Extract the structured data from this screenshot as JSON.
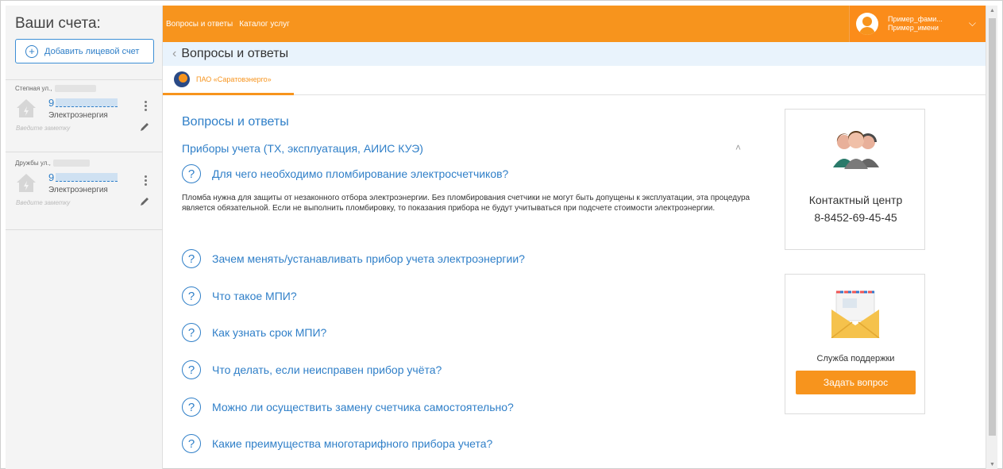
{
  "sidebar": {
    "title": "Ваши счета:",
    "add_account_label": "Добавить лицевой счет",
    "accounts": [
      {
        "address": "Степная ул.,",
        "number_prefix": "9",
        "type": "Электроэнергия",
        "note_placeholder": "Введите заметку"
      },
      {
        "address": "Дружбы ул.,",
        "number_prefix": "9",
        "type": "Электроэнергия",
        "note_placeholder": "Введите заметку"
      }
    ]
  },
  "topbar": {
    "nav": [
      "Вопросы и ответы",
      "Каталог услуг"
    ],
    "user_line1": "Пример_фами...",
    "user_line2": "Пример_имени"
  },
  "breadcrumb": {
    "title": "Вопросы и ответы"
  },
  "company_tab": {
    "name": "ПАО «Саратовэнерго»"
  },
  "faq": {
    "heading": "Вопросы и ответы",
    "section_title": "Приборы учета (ТХ, эксплуатация, АИИС КУЭ)",
    "questions": [
      "Для чего необходимо пломбирование электросчетчиков?",
      "Зачем менять/устанавливать прибор учета электроэнергии?",
      "Что такое МПИ?",
      "Как узнать срок МПИ?",
      "Что делать, если неисправен прибор учёта?",
      "Можно ли осуществить замену счетчика самостоятельно?",
      "Какие преимущества многотарифного прибора учета?"
    ],
    "answer": "Пломба нужна для защиты от незаконного отбора электроэнергии. Без пломбирования счетчики не могут быть допущены к эксплуатации, эта процедура является обязательной. Если не выполнить пломбировку, то показания прибора не будут учитываться при подсчете стоимости электроэнергии."
  },
  "contact_card": {
    "title": "Контактный центр",
    "phone": "8-8452-69-45-45"
  },
  "support_card": {
    "title": "Служба поддержки",
    "button_label": "Задать вопрос"
  },
  "colors": {
    "accent": "#f7941d",
    "link": "#2f7fc8",
    "crumb_bg": "#e9f3fc"
  }
}
